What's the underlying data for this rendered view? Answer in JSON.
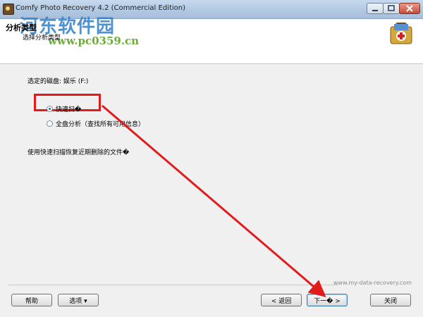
{
  "window": {
    "title": "Comfy Photo Recovery 4.2 (Commercial Edition)"
  },
  "header": {
    "section_title": "分析类型",
    "section_subtitle": "选择分析类型",
    "watermark_text": "河东软件园",
    "watermark_url": "www.pc0359.cn"
  },
  "main": {
    "disk_label": "选定的磁盘: 娱乐 (F:)",
    "options": [
      {
        "label": "快速扫�",
        "selected": true
      },
      {
        "label": "全盘分析（查找所有可用信息）",
        "selected": false
      }
    ],
    "description": "使用快速扫描恢复近期删除的文件�",
    "footer_url": "www.my-data-recovery.com"
  },
  "buttons": {
    "help": "帮助",
    "options": "选项 ▾",
    "back": "< 返回",
    "next": "下一� >",
    "close": "关闭"
  },
  "colors": {
    "annotation": "#e11b1b",
    "titlebar": "#b9cee6"
  }
}
